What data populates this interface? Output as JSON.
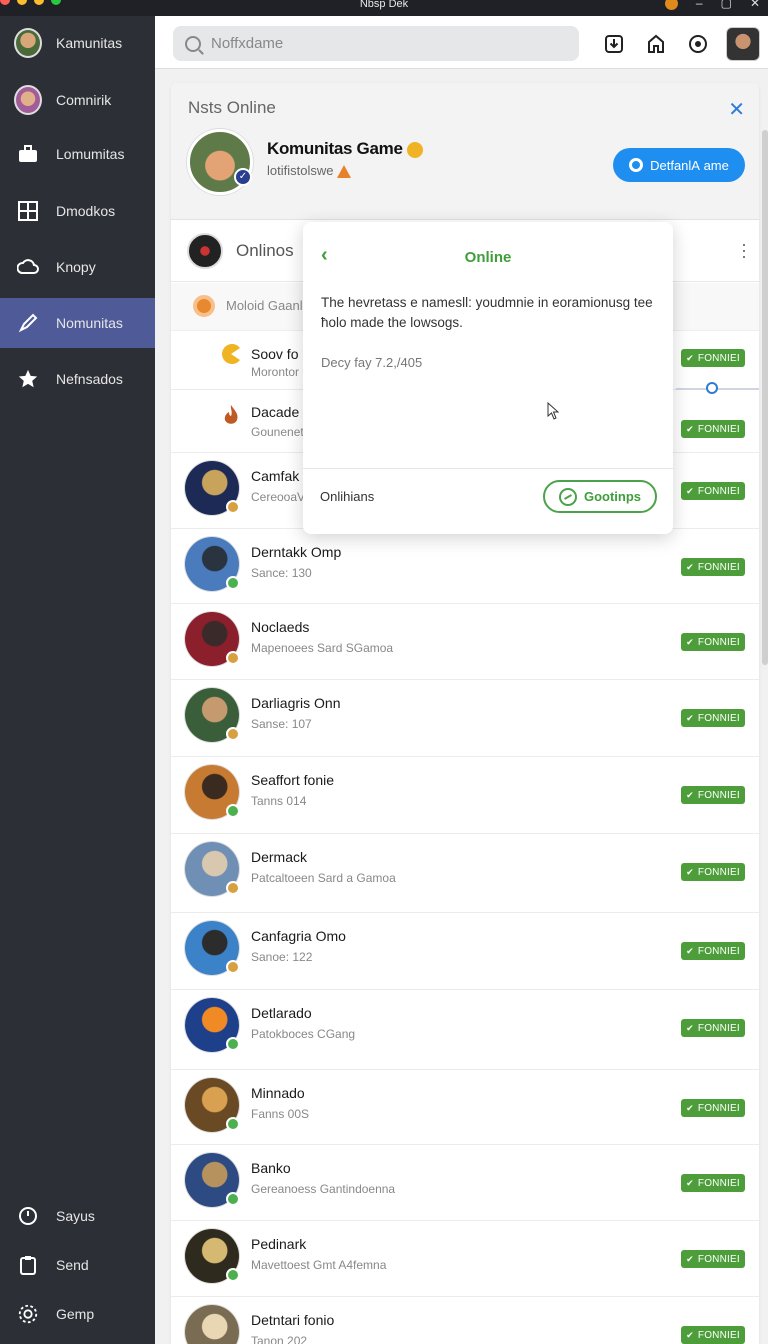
{
  "window": {
    "title": "Nbsp Dek"
  },
  "sidebar": {
    "items": [
      {
        "label": "Kamunitas",
        "icon": "user-avatar-icon"
      },
      {
        "label": "Comnirik",
        "icon": "user-avatar-icon"
      },
      {
        "label": "Lomumitas",
        "icon": "briefcase-icon"
      },
      {
        "label": "Dmodkos",
        "icon": "grid-icon"
      },
      {
        "label": "Knopy",
        "icon": "cloud-icon"
      },
      {
        "label": "Nomunitas",
        "icon": "brush-icon"
      },
      {
        "label": "Nefnsados",
        "icon": "star-icon"
      }
    ],
    "bottom": [
      {
        "label": "Sayus",
        "icon": "clock-icon"
      },
      {
        "label": "Send",
        "icon": "clipboard-icon"
      },
      {
        "label": "Gemp",
        "icon": "gear-icon"
      }
    ]
  },
  "search": {
    "placeholder": "Noffxdame"
  },
  "panel": {
    "title": "Nsts Online",
    "profile_name": "Komunitas Game",
    "profile_sub": "lotifistolswe",
    "primary_button": "DetfanlА ame",
    "section_title": "Onlinos",
    "subhead": "Moloid Gaanle"
  },
  "popover": {
    "title": "Online",
    "body": "The hevretass e namesll: youdmnie in eoramionusg tee ħolo made the lowsogs.",
    "meta": "Decy fay 7.2,/405",
    "footer_label": "Onlihians",
    "button": "Gootinps"
  },
  "badge_label": "FONNIEI",
  "rows": [
    {
      "name": "Soov fo",
      "sub": "Morontor"
    },
    {
      "name": "Dacade",
      "sub": "Gounenet"
    },
    {
      "name": "Camfak",
      "sub": "CereooaV"
    },
    {
      "name": "Derntakk Omp",
      "sub": "Sance: 130"
    },
    {
      "name": "Noclaeds",
      "sub": "Mapenoees Sard SGamoa"
    },
    {
      "name": "Darliagris Onn",
      "sub": "Sanse: 107"
    },
    {
      "name": "Seaffort fonie",
      "sub": "Tanns 014"
    },
    {
      "name": "Dermack",
      "sub": "Patcaltoeen Sard a Gamoa"
    },
    {
      "name": "Canfagria Omo",
      "sub": "Sanoe: 122"
    },
    {
      "name": "Detlarado",
      "sub": "Patokboces CGang"
    },
    {
      "name": "Minnado",
      "sub": "Fanns 00S"
    },
    {
      "name": "Banko",
      "sub": "Gereanoess Gantindoenna"
    },
    {
      "name": "Pedinark",
      "sub": "Mavettoest Gmt A4femna"
    },
    {
      "name": "Detntari fonio",
      "sub": "Tanon 202"
    }
  ],
  "colors": {
    "accent": "#1e8ef0",
    "online_green": "#4d9e3a",
    "sidebar_bg": "#2c2f35",
    "sidebar_active": "#4f5a98"
  }
}
